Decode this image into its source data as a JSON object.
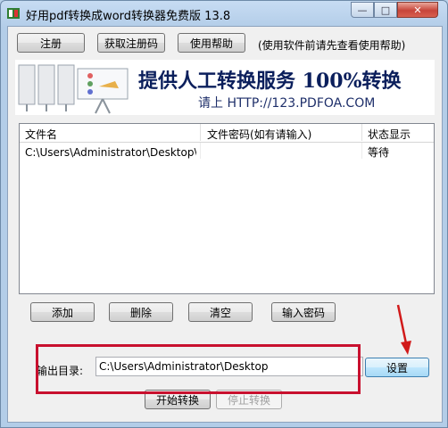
{
  "window": {
    "title": "好用pdf转换成word转换器免费版 13.8",
    "close_symbol": "✕",
    "min_symbol": "—",
    "max_symbol": "□"
  },
  "toolbar": {
    "register": "注册",
    "get_code": "获取注册码",
    "help": "使用帮助",
    "notice": "(使用软件前请先查看使用帮助)"
  },
  "banner": {
    "headline": "提供人工转换服务 100%转换",
    "contact": "请上  HTTP://123.PDFOA.COM"
  },
  "file_table": {
    "headers": [
      "文件名",
      "文件密码(如有请输入)",
      "状态显示"
    ],
    "rows": [
      {
        "name": "C:\\Users\\Administrator\\Desktop\\新建...",
        "password": "",
        "status": "等待"
      }
    ]
  },
  "list_actions": {
    "add": "添加",
    "delete": "删除",
    "clear": "清空",
    "enter_password": "输入密码"
  },
  "output": {
    "label": "输出目录:",
    "path": "C:\\Users\\Administrator\\Desktop",
    "settings": "设置"
  },
  "convert": {
    "start": "开始转换",
    "stop": "停止转换"
  },
  "colors": {
    "highlight_box": "#c8102e",
    "arrow": "#d11a1a",
    "banner_text": "#0b1f5c"
  }
}
